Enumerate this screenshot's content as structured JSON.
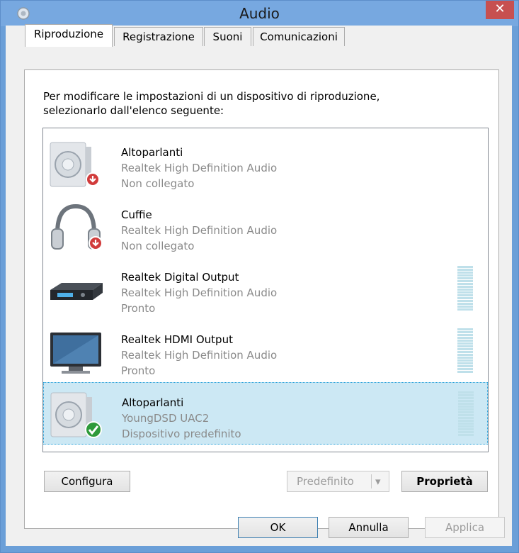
{
  "window": {
    "title": "Audio",
    "close_glyph": "✕"
  },
  "tabs": [
    {
      "label": "Riproduzione",
      "active": true
    },
    {
      "label": "Registrazione",
      "active": false
    },
    {
      "label": "Suoni",
      "active": false
    },
    {
      "label": "Comunicazioni",
      "active": false
    }
  ],
  "instructions": {
    "line1": "Per modificare le impostazioni di un dispositivo di riproduzione,",
    "line2": "selezionarlo dall'elenco seguente:"
  },
  "devices": [
    {
      "name": "Altoparlanti",
      "driver": "Realtek High Definition Audio",
      "status": "Non collegato",
      "icon": "speaker-icon",
      "badge": "disconnected-badge-icon",
      "meter": false,
      "selected": false
    },
    {
      "name": "Cuffie",
      "driver": "Realtek High Definition Audio",
      "status": "Non collegato",
      "icon": "headphones-icon",
      "badge": "disconnected-badge-icon",
      "meter": false,
      "selected": false
    },
    {
      "name": "Realtek Digital Output",
      "driver": "Realtek High Definition Audio",
      "status": "Pronto",
      "icon": "digital-output-device-icon",
      "badge": "",
      "meter": true,
      "selected": false
    },
    {
      "name": "Realtek HDMI Output",
      "driver": "Realtek High Definition Audio",
      "status": "Pronto",
      "icon": "monitor-icon",
      "badge": "",
      "meter": true,
      "selected": false
    },
    {
      "name": "Altoparlanti",
      "driver": "YoungDSD UAC2",
      "status": "Dispositivo predefinito",
      "icon": "speaker-icon",
      "badge": "default-check-badge-icon",
      "meter": true,
      "selected": true
    }
  ],
  "buttons": {
    "configure": "Configura",
    "set_default": "Predefinito",
    "properties": "Proprietà",
    "ok": "OK",
    "cancel": "Annulla",
    "apply": "Applica"
  },
  "colors": {
    "titlebar": "#77a8e0",
    "selection": "#cce8f4",
    "meter": "#bfe0ea",
    "check_badge": "#2e9a3a",
    "disconnected_badge": "#d13b3b"
  }
}
